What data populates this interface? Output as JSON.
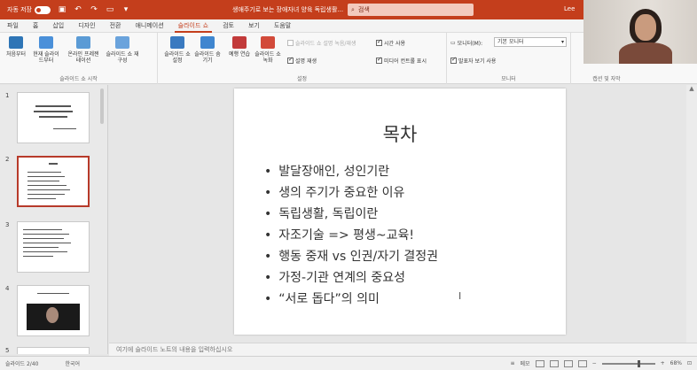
{
  "titlebar": {
    "autosave_label": "자동 저장",
    "autosave_state": "끔",
    "doc_title": "생애주기로 보는 장애자녀 양육 독립생활...",
    "search_label": "검색",
    "user": "Lee"
  },
  "tabs": [
    "파일",
    "홈",
    "삽입",
    "디자인",
    "전환",
    "애니메이션",
    "슬라이드 쇼",
    "검토",
    "보기",
    "도움말"
  ],
  "active_tab": "슬라이드 쇼",
  "ribbon": {
    "groups": {
      "start": "슬라이드 쇼 시작",
      "setup": "설정",
      "monitors": "모니터",
      "captions": "캡션 및 자막"
    },
    "buttons": {
      "from_beginning": "처음부터",
      "from_current": "현재 슬라이드부터",
      "online": "온라인 프레젠테이션",
      "custom": "슬라이드 쇼 재구성",
      "setup_show": "슬라이드 쇼 설정",
      "hide_slide": "슬라이드 숨기기",
      "rehearse": "예행 연습",
      "record": "슬라이드 쇼 녹화"
    },
    "checks": {
      "play_narrations": "슬라이드 쇼 설명 녹음/재생",
      "use_timings": "시간 사용",
      "show_media_controls": "미디어 컨트롤 표시",
      "narration_play": "설명 재생",
      "presenter_view": "발표자 보기 사용"
    },
    "monitor_label": "모니터(M):",
    "monitor_value": "기본 모니터"
  },
  "thumbnails": [
    {
      "num": "1"
    },
    {
      "num": "2"
    },
    {
      "num": "3"
    },
    {
      "num": "4"
    },
    {
      "num": "5"
    }
  ],
  "slide": {
    "title": "목차",
    "bullets": [
      "발달장애인, 성인기란",
      "생의 주기가 중요한 이유",
      "독립생활, 독립이란",
      "자조기술 => 평생~교육!",
      "행동 중재 vs 인권/자기 결정권",
      "가정-기관 연계의 중요성",
      "“서로 돕다”의 의미"
    ]
  },
  "notes_placeholder": "여기에 슬라이드 노트의 내용을 입력하십시오",
  "status": {
    "slide_info": "슬라이드 2/40",
    "language": "한국어",
    "notes_btn": "메모",
    "zoom": "68%"
  },
  "colors": {
    "accent": "#c43e1c",
    "selected_thumb": "#b73a2a"
  }
}
